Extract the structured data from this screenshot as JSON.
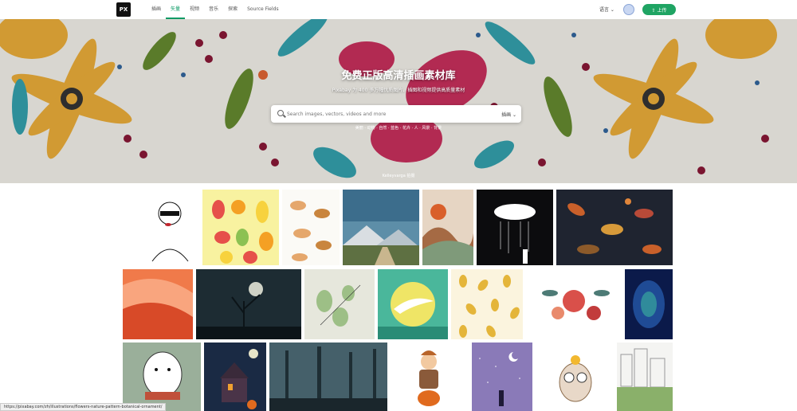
{
  "nav": {
    "logo": "PX",
    "items": [
      "插画",
      "矢量",
      "视频",
      "音乐",
      "探索",
      "Source Fields"
    ],
    "active_index": 1
  },
  "header": {
    "lang": "语言 ⌄",
    "upload": "⇧ 上传"
  },
  "hero": {
    "title": "免费正版高清插画素材库",
    "subtitle": "Pixabay 为 400 多万幅优质图片、插图和视频提供高质量素材",
    "search_placeholder": "Search images, vectors, videos and more",
    "search_type": "插画 ⌄",
    "popular": "美丽 · 动物 · 自然 · 蓝色 · 花卉 · 人 · 风景 · 背景",
    "credit": "Kelleyvarga 拍摄"
  },
  "status_bar": "https://pixabay.com/zh/illustrations/flowers-nature-pattern-botanical-ornament/"
}
